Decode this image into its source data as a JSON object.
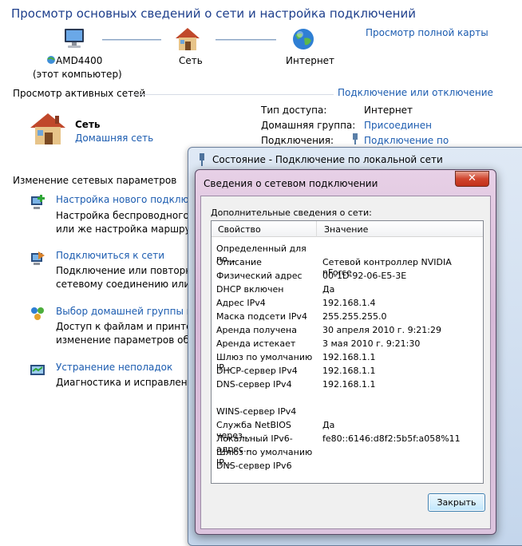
{
  "header": {
    "title": "Просмотр основных сведений о сети и настройка подключений",
    "full_map_link": "Просмотр полной карты"
  },
  "map": {
    "computer_name": "AMD4400",
    "computer_sub": "(этот компьютер)",
    "network_label": "Сеть",
    "internet_label": "Интернет"
  },
  "active": {
    "section_label": "Просмотр активных сетей",
    "connect_link": "Подключение или отключение",
    "network_name": "Сеть",
    "network_type": "Домашняя сеть",
    "access_type_label": "Тип доступа:",
    "access_type_value": "Интернет",
    "homegroup_label": "Домашняя группа:",
    "homegroup_value": "Присоединен",
    "connections_label": "Подключения:",
    "connections_value": "Подключение по"
  },
  "settings": {
    "section_label": "Изменение сетевых параметров",
    "items": [
      {
        "link": "Настройка нового подключе",
        "desc1": "Настройка беспроводного, ш",
        "desc2": "или же настройка маршрутиз"
      },
      {
        "link": "Подключиться к сети",
        "desc1": "Подключение или повторное",
        "desc2": "сетевому соединению или под"
      },
      {
        "link": "Выбор домашней группы и па",
        "desc1": "Доступ к файлам и принтерам",
        "desc2": "изменение параметров общег"
      },
      {
        "link": "Устранение неполадок",
        "desc1": "Диагностика и исправление се",
        "desc2": ""
      }
    ]
  },
  "status_dialog": {
    "title": "Состояние - Подключение по локальной сети"
  },
  "details_dialog": {
    "title": "Сведения о сетевом подключении",
    "close_glyph": "✕",
    "group_label": "Дополнительные сведения о сети:",
    "col_property": "Свойство",
    "col_value": "Значение",
    "rows": [
      {
        "p": "Определенный для по...",
        "v": ""
      },
      {
        "p": "Описание",
        "v": "Сетевой контроллер NVIDIA nForce"
      },
      {
        "p": "Физический адрес",
        "v": "00-1D-92-06-E5-3E"
      },
      {
        "p": "DHCP включен",
        "v": "Да"
      },
      {
        "p": "Адрес IPv4",
        "v": "192.168.1.4"
      },
      {
        "p": "Маска подсети IPv4",
        "v": "255.255.255.0"
      },
      {
        "p": "Аренда получена",
        "v": "30 апреля 2010 г. 9:21:29"
      },
      {
        "p": "Аренда истекает",
        "v": "3 мая 2010 г. 9:21:30"
      },
      {
        "p": "Шлюз по умолчанию IP...",
        "v": "192.168.1.1"
      },
      {
        "p": "DHCP-сервер IPv4",
        "v": "192.168.1.1"
      },
      {
        "p": "DNS-сервер IPv4",
        "v": "192.168.1.1"
      },
      {
        "p": "",
        "v": ""
      },
      {
        "p": "WINS-сервер IPv4",
        "v": ""
      },
      {
        "p": "Служба NetBIOS через...",
        "v": "Да"
      },
      {
        "p": "Локальный IPv6-адрес...",
        "v": "fe80::6146:d8f2:5b5f:a058%11"
      },
      {
        "p": "Шлюз по умолчанию IP...",
        "v": ""
      },
      {
        "p": "DNS-сервер IPv6",
        "v": ""
      }
    ],
    "close_button": "Закрыть"
  }
}
